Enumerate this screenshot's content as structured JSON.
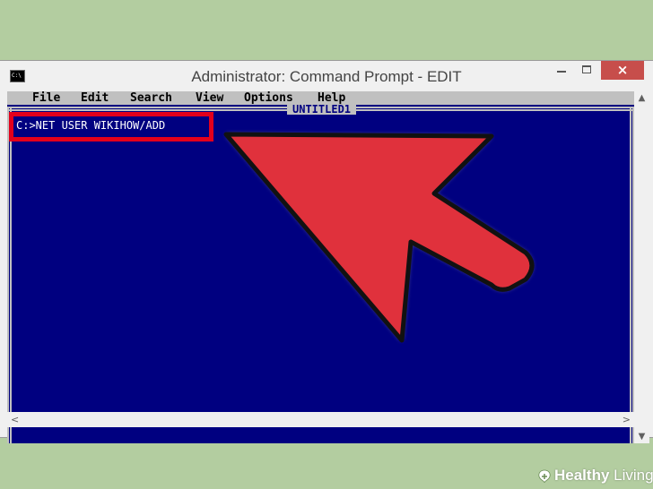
{
  "window": {
    "title": "Administrator: Command Prompt - EDIT",
    "app_icon_text": "C:\\",
    "close_glyph": "×"
  },
  "menu": {
    "items": [
      {
        "label": "File"
      },
      {
        "label": "Edit"
      },
      {
        "label": "Search"
      },
      {
        "label": "View"
      },
      {
        "label": "Options"
      },
      {
        "label": "Help"
      }
    ]
  },
  "editor": {
    "document_title": "UNTITLED1",
    "command": "C:>NET USER WIKIHOW/ADD"
  },
  "scrollbars": {
    "up_icon": "▲",
    "down_icon": "▼",
    "left_icon": "<",
    "right_icon": ">"
  },
  "watermark": {
    "brand_bold": "Healthy",
    "brand_light": " Living"
  },
  "colors": {
    "console_bg": "#000080",
    "highlight": "#e3001b",
    "arrow_fill": "#e0313c",
    "page_bg": "#b3cda0",
    "close_button": "#c74e4b"
  }
}
